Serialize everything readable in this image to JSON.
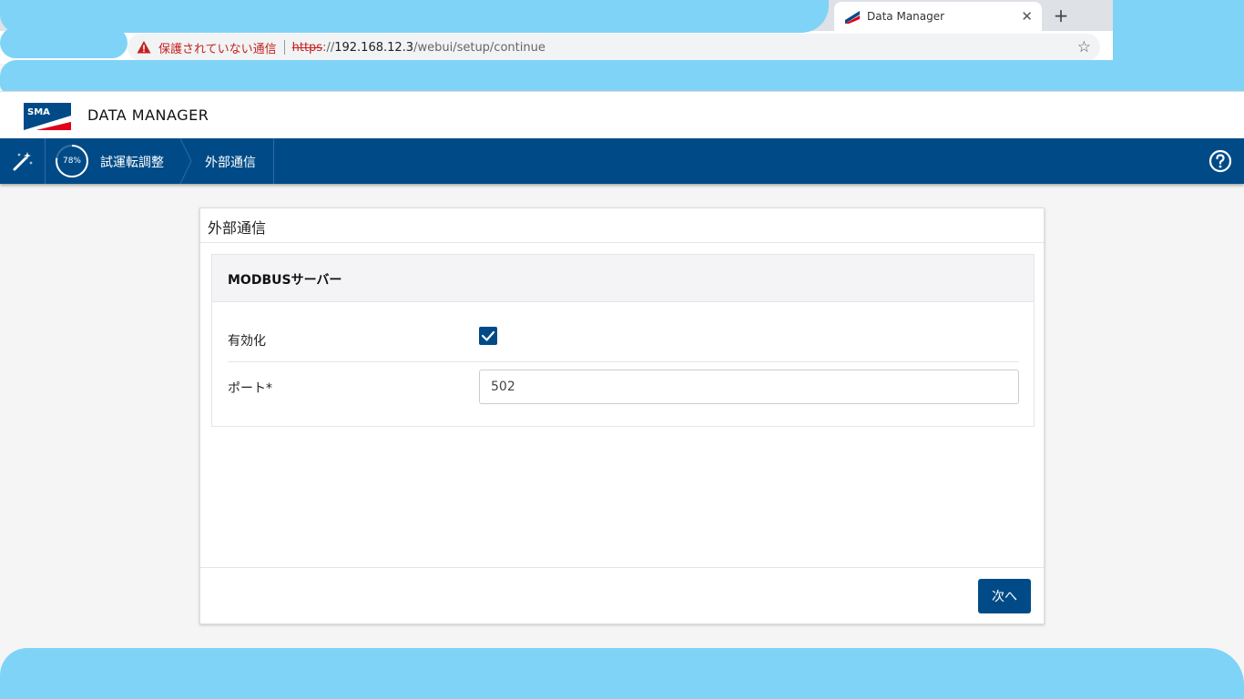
{
  "browser": {
    "tab_title": "Data Manager",
    "tab_close_icon": "close-icon",
    "new_tab_icon": "plus-icon",
    "security_label": "保護されていない通信",
    "url_scheme": "https",
    "url_sep": "://",
    "url_host": "192.168.12.3",
    "url_path": "/webui/setup/continue",
    "bookmark_icon": "star-icon"
  },
  "app": {
    "logo_text": "SMA",
    "title": "DATA MANAGER"
  },
  "nav": {
    "wizard_icon": "magic-wand-icon",
    "progress_percent": 78,
    "progress_label": "78%",
    "breadcrumb": [
      "試運転調整",
      "外部通信"
    ],
    "help_icon": "question-icon"
  },
  "card": {
    "title": "外部通信",
    "section_title": "MODBUSサーバー",
    "enable_label": "有効化",
    "enable_checked": true,
    "port_label": "ポート*",
    "port_value": "502",
    "next_button": "次へ"
  },
  "colors": {
    "primary": "#004b87",
    "scribble": "#7fd3f7"
  }
}
